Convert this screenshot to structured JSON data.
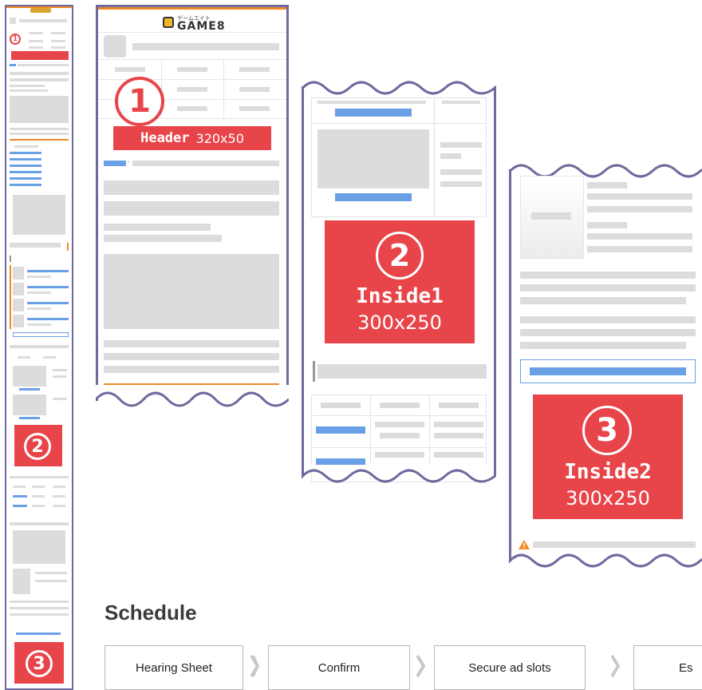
{
  "logo": {
    "kana": "ゲームエイト",
    "name": "GAME8"
  },
  "mini_preview": {
    "badge_top": "①",
    "badge_bottom": "③"
  },
  "placements": [
    {
      "number": "1",
      "name": "Header",
      "size": "320x50"
    },
    {
      "number": "2",
      "name": "Inside1",
      "size": "300x250"
    },
    {
      "number": "3",
      "name": "Inside2",
      "size": "300x250"
    }
  ],
  "schedule": {
    "title": "Schedule",
    "steps": [
      "Hearing Sheet",
      "Confirm",
      "Secure ad slots",
      "Es"
    ]
  },
  "colors": {
    "accent_red": "#e8454a",
    "frame": "#6e6a9e",
    "placeholder": "#dcdcdc",
    "link_blue": "#6aa0e6",
    "orange": "#f08a24"
  }
}
